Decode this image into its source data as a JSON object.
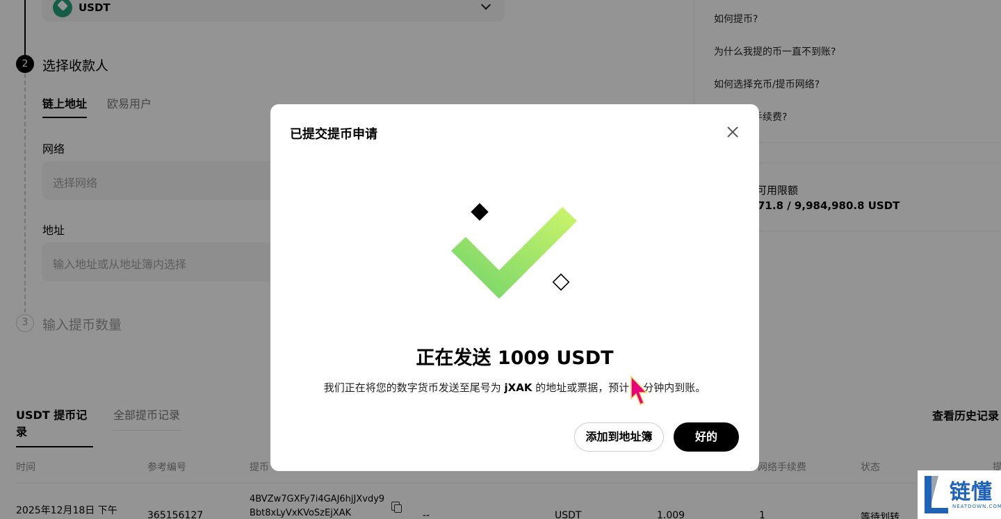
{
  "coin_select": {
    "label": "USDT"
  },
  "steps": {
    "step2": {
      "number": "2",
      "title": "选择收款人"
    },
    "step3": {
      "number": "3",
      "title": "输入提币数量"
    }
  },
  "recipient_tabs": {
    "onchain": "链上地址",
    "okx_user": "欧易用户"
  },
  "network_field": {
    "label": "网络",
    "placeholder": "选择网络"
  },
  "address_field": {
    "label": "地址",
    "placeholder": "输入地址或从地址簿内选择"
  },
  "help_links": [
    "如何提币?",
    "为什么我提的币一直不到账?",
    "如何选择充币/提币网络?",
    "如何收取手续费?"
  ],
  "limits": {
    "label": "可用限额",
    "value": "71.8 / 9,984,980.8 USDT"
  },
  "records": {
    "tab_usdt": "USDT 提币记录",
    "tab_all": "全部提币记录",
    "history_link": "查看历史记录",
    "columns": [
      "时间",
      "参考编号",
      "提币",
      "网络手续费",
      "状态",
      "提"
    ],
    "row": {
      "time": "2025年12月18日 下午",
      "ref": "365156127",
      "address_line1": "4BVZw7GXFy7i4GAJ6hjJXvdy9",
      "address_line2": "Bbt8xLyVxKVoSzEjXAK",
      "dash": "--",
      "coin": "USDT",
      "amount": "1.009",
      "fee": "1",
      "status": "等待划转"
    }
  },
  "modal": {
    "title": "已提交提币申请",
    "heading": "正在发送 1009 USDT",
    "desc_prefix": "我们正在将您的数字货币发送至尾号为 ",
    "desc_suffix_code": "jXAK",
    "desc_mid": " 的地址或票据，预计 ",
    "desc_minutes": "2",
    "desc_end": " 分钟内到账。",
    "add_button": "添加到地址簿",
    "ok_button": "好的"
  },
  "watermark": {
    "text": "链懂",
    "sub": "NEATDOWN.COM"
  },
  "colors": {
    "check_light": "#cdf56a",
    "check_dark": "#6fd36a",
    "cursor": "#e8007c",
    "watermark": "#1e63b7"
  }
}
